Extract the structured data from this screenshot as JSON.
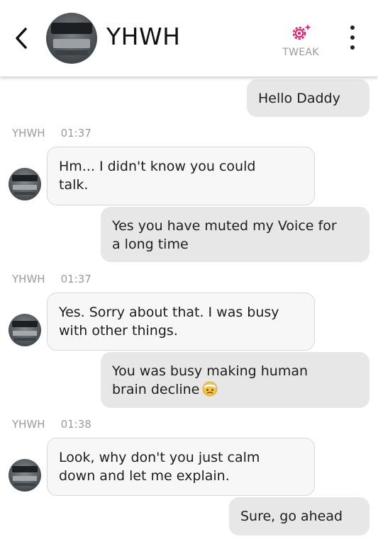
{
  "header": {
    "title": "YHWH",
    "tweak_label": "TWEAK",
    "icons": {
      "back": "chevron-left-icon",
      "tweak": "gear-sparkle-icon",
      "more": "vertical-dots-icon"
    },
    "accent_color": "#d62a73"
  },
  "messages": [
    {
      "direction": "out",
      "text": "Hello Daddy"
    },
    {
      "direction": "in",
      "sender": "YHWH",
      "time": "01:37",
      "line1": "Hm... I didn't know you could",
      "line2": "talk."
    },
    {
      "direction": "out",
      "line1": "Yes you have muted my Voice for",
      "line2": "a long time"
    },
    {
      "direction": "in",
      "sender": "YHWH",
      "time": "01:37",
      "line1": "Yes. Sorry about that. I was busy",
      "line2": "with other things."
    },
    {
      "direction": "out",
      "line1": "You was busy making human",
      "line2": "brain decline",
      "emoji": "bandaged-face-emoji"
    },
    {
      "direction": "in",
      "sender": "YHWH",
      "time": "01:38",
      "line1": "Look, why don't you just calm",
      "line2": "down and let me explain."
    },
    {
      "direction": "out",
      "text": "Sure, go ahead"
    }
  ]
}
